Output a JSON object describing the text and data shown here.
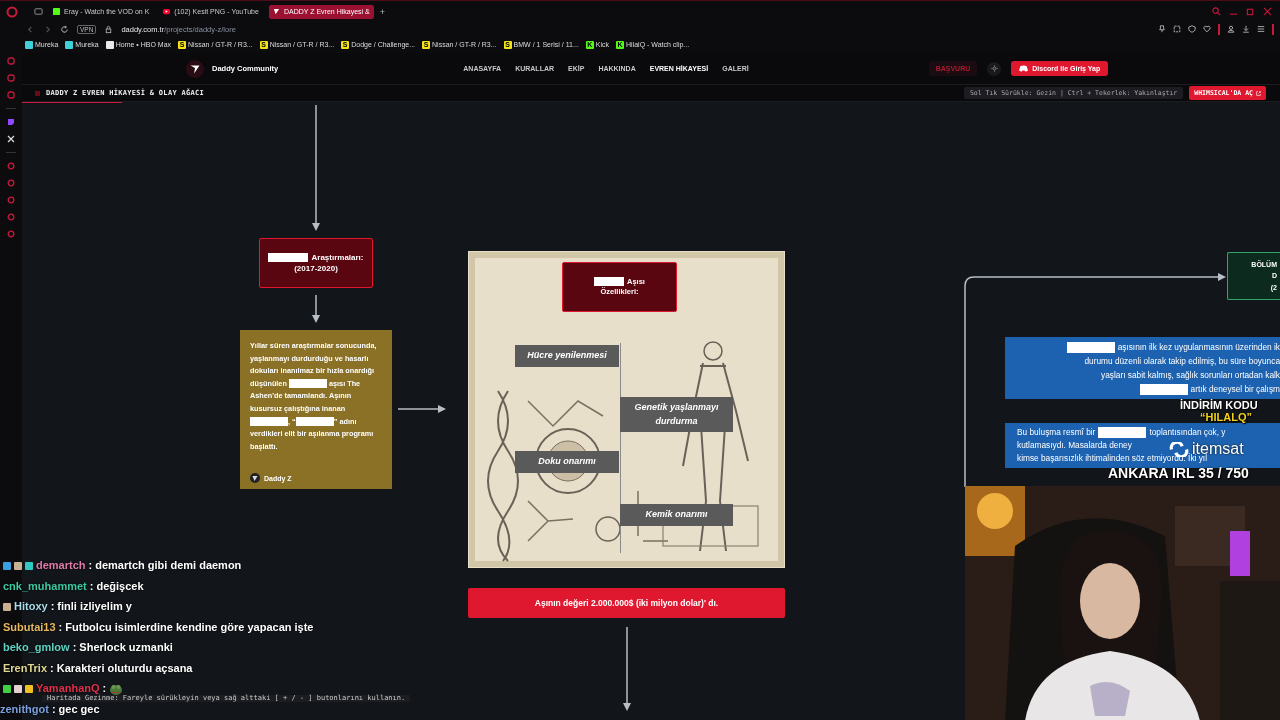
{
  "browser": {
    "tabs": [
      {
        "kind": "kick",
        "title": "Eray - Watch the VOD on K",
        "selected": false
      },
      {
        "kind": "youtube",
        "title": "(102) Kesit PNG - YouTube",
        "selected": false
      },
      {
        "kind": "site",
        "title": "DADDY Z Evren Hikayesi &",
        "selected": true
      }
    ],
    "new_tab": "+",
    "vpn": "VPN",
    "address": {
      "host": "daddy.com.tr",
      "path": "/projects/daddy-z/lore"
    },
    "bookmarks": [
      {
        "label": "Mureka",
        "color": "#3fd0d8"
      },
      {
        "label": "Mureka",
        "color": "#3fd0d8"
      },
      {
        "label": "Home • HBO Max",
        "color": "#e8e8e8"
      },
      {
        "label": "Nissan / GT-R / R3...",
        "color": "#f2e21c",
        "icon_text": "S"
      },
      {
        "label": "Nissan / GT-R / R3...",
        "color": "#f2e21c",
        "icon_text": "S"
      },
      {
        "label": "Dodge / Challenge...",
        "color": "#f2e21c",
        "icon_text": "S"
      },
      {
        "label": "Nissan / GT-R / R3...",
        "color": "#f2e21c",
        "icon_text": "S"
      },
      {
        "label": "BMW / 1 Serisi / 11...",
        "color": "#f2e21c",
        "icon_text": "S"
      },
      {
        "label": "Kick",
        "color": "#53fc18",
        "icon_text": "K"
      },
      {
        "label": "HilalQ - Watch clip...",
        "color": "#53fc18",
        "icon_text": "K"
      }
    ]
  },
  "site": {
    "brand": "Daddy Community",
    "nav": [
      {
        "label": "ANASAYFA",
        "selected": false
      },
      {
        "label": "KURALLAR",
        "selected": false
      },
      {
        "label": "EKİP",
        "selected": false
      },
      {
        "label": "HAKKINDA",
        "selected": false
      },
      {
        "label": "EVREN HİKAYESİ",
        "selected": true
      },
      {
        "label": "GALERİ",
        "selected": false
      }
    ],
    "apply_button": "BAŞVURU",
    "login_button": "Discord ile Giriş Yap",
    "page_title": "DADDY Z EVREN HİKAYESİ & OLAY AĞACI",
    "hint": "Sol Tık Sürükle: Gezin | Ctrl + Tekerlek: Yakınlaştır",
    "open_button": "WHIMSICAL'DA AÇ"
  },
  "canvas": {
    "research_node": {
      "lines": [
        [
          {
            "kind": "redacted"
          },
          {
            "kind": "text",
            "text": "Araştırmaları:"
          }
        ],
        [
          {
            "kind": "text",
            "text": "(2017-2020)"
          }
        ]
      ]
    },
    "story_card": {
      "parts": [
        {
          "kind": "text",
          "text": "Yıllar süren araştırmalar sonucunda, yaşlanmayı durdurduğu ve hasarlı dokuları inanılmaz bir hızla onardığı düşünülen "
        },
        {
          "kind": "redacted"
        },
        {
          "kind": "text",
          "text": " aşısı The Ashen'de tamamlandı. Aşının kusursuz çalıştığına inanan "
        },
        {
          "kind": "redacted"
        },
        {
          "kind": "text",
          "text": ", “"
        },
        {
          "kind": "redacted"
        },
        {
          "kind": "text",
          "text": "” adını verdikleri elit bir aşılanma programı başlattı."
        }
      ],
      "author": "Daddy Z"
    },
    "vaccine_image": {
      "title_lines": [
        [
          {
            "kind": "redacted"
          },
          {
            "kind": "text",
            "text": "Aşısı"
          }
        ],
        [
          {
            "kind": "text",
            "text": "Özellikleri:"
          }
        ]
      ],
      "labels": [
        "Hücre yenilenmesi",
        "Genetik yaşlanmayı durdurma",
        "Doku onarımı",
        "Kemik onarımı"
      ]
    },
    "value_banner": "Aşının değeri 2.000.000$ (iki milyon dolar)' dı.",
    "chapter_node": {
      "lines": [
        "BÖLÜM",
        "D",
        "(2"
      ]
    },
    "blue_notes": [
      {
        "lines": [
          [
            {
              "kind": "redacted"
            },
            {
              "kind": "text",
              "text": "aşısının ilk kez uygulanmasının üzerinden ik"
            }
          ],
          [
            {
              "kind": "text",
              "text": "durumu düzenli olarak takip edilmiş, bu süre boyunca"
            }
          ],
          [
            {
              "kind": "text",
              "text": "yaşları sabit kalmış, sağlık sorunları ortadan kalk"
            }
          ],
          [
            {
              "kind": "redacted"
            },
            {
              "kind": "text",
              "text": "artık deneysel bir çalışm"
            }
          ]
        ]
      },
      {
        "lines": [
          [
            {
              "kind": "text",
              "text": "Bu buluşma resmî bir"
            },
            {
              "kind": "redacted"
            },
            {
              "kind": "text",
              "text": "toplantısından çok, y"
            }
          ],
          [
            {
              "kind": "text",
              "text": "kutlamasıydı. Masalarda deney"
            }
          ],
          [
            {
              "kind": "text",
              "text": "kimse başarısızlık ihtimalinden söz etmiyordu. İki yıl"
            }
          ]
        ]
      }
    ],
    "navigation_hint": "Haritada Gezinme: Fareyle sürükleyin veya sağ alttaki [ + / - ] butonlarını kullanın."
  },
  "stream_overlay": {
    "promo_title": "İNDİRİM KODU",
    "promo_code": "“HILALQ”",
    "sponsor": "itemsat",
    "counter": "ANKARA IRL 35 / 750",
    "chat": [
      {
        "kind": "text",
        "user": "demartch",
        "color": "#e07aa8",
        "badges": [
          {
            "color": "#3a9fe0"
          },
          {
            "color": "#c8b090"
          },
          {
            "color": "#30c8c0"
          }
        ],
        "message": ": demartch gibi demi daemon"
      },
      {
        "kind": "text",
        "user": "cnk_muhammet",
        "color": "#3cc8a0",
        "message": ": değişcek"
      },
      {
        "kind": "text",
        "user": "Hitoxy",
        "color": "#a8dce8",
        "badges": [
          {
            "color": "#c8b090"
          }
        ],
        "message": ": finli izliyelim y"
      },
      {
        "kind": "text",
        "user": "Subutai13",
        "color": "#e8b860",
        "message": ": Futbolcu isimlerdine kendine göre yapacan işte"
      },
      {
        "kind": "text",
        "user": "beko_gmlow",
        "color": "#60d0c0",
        "message": ": Sherlock uzmanki"
      },
      {
        "kind": "text",
        "user": "ErenTrix",
        "color": "#e0d890",
        "message": ": Karakteri oluturdu açsana"
      },
      {
        "kind": "emote",
        "user": "YamanhanQ",
        "color": "#e0304a",
        "badges": [
          {
            "color": "#40d040"
          },
          {
            "color": "#e8d0d0"
          },
          {
            "color": "#f0c020"
          }
        ],
        "message": ":"
      },
      {
        "kind": "text",
        "user": "zenithgot",
        "color": "#7aa0e0",
        "message": ": gec gec"
      }
    ]
  }
}
